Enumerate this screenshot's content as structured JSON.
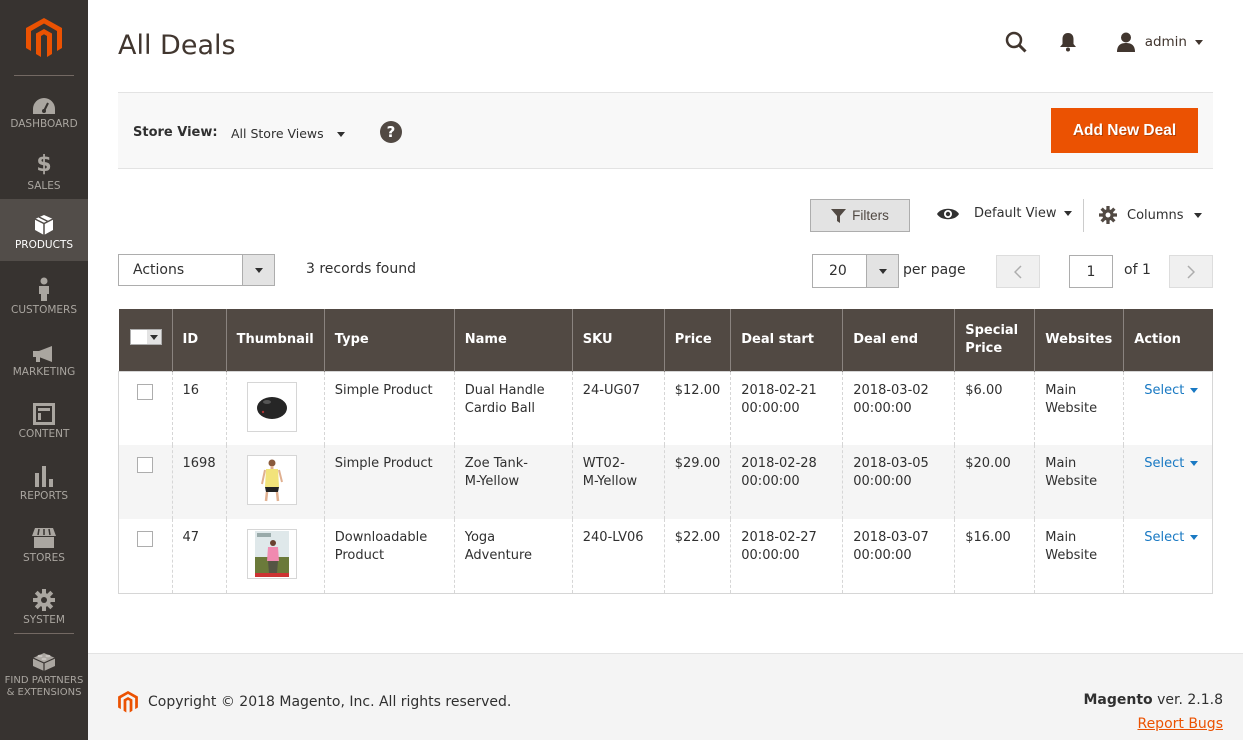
{
  "sidebar": {
    "items": [
      {
        "label": "DASHBOARD",
        "icon": "dashboard-icon"
      },
      {
        "label": "SALES",
        "icon": "dollar-icon"
      },
      {
        "label": "PRODUCTS",
        "icon": "box-icon",
        "active": true
      },
      {
        "label": "CUSTOMERS",
        "icon": "person-icon"
      },
      {
        "label": "MARKETING",
        "icon": "megaphone-icon"
      },
      {
        "label": "CONTENT",
        "icon": "layout-icon"
      },
      {
        "label": "REPORTS",
        "icon": "bar-chart-icon"
      },
      {
        "label": "STORES",
        "icon": "storefront-icon"
      },
      {
        "label": "SYSTEM",
        "icon": "gear-icon"
      }
    ],
    "extensions": {
      "line1": "FIND PARTNERS",
      "line2": "& EXTENSIONS",
      "icon": "lego-block-icon"
    }
  },
  "header": {
    "title": "All Deals",
    "user": "admin"
  },
  "store_bar": {
    "label": "Store View:",
    "selected": "All Store Views",
    "add_button": "Add New Deal"
  },
  "toolbar": {
    "filters": "Filters",
    "view": "Default View",
    "columns": "Columns",
    "actions": "Actions",
    "records": "3 records found",
    "per_page_value": "20",
    "per_page_label": "per page",
    "page": "1",
    "of_pages": "of 1"
  },
  "grid": {
    "columns": [
      "ID",
      "Thumbnail",
      "Type",
      "Name",
      "SKU",
      "Price",
      "Deal start",
      "Deal end",
      "Special Price",
      "Websites",
      "Action"
    ],
    "special_price_line1": "Special",
    "special_price_line2": "Price",
    "rows": [
      {
        "id": "16",
        "thumb": "cardio-ball",
        "type": "Simple Product",
        "name": "Dual Handle Cardio Ball",
        "sku": "24-UG07",
        "price": "$12.00",
        "deal_start_date": "2018-02-21",
        "deal_start_time": "00:00:00",
        "deal_end_date": "2018-03-02",
        "deal_end_time": "00:00:00",
        "special_price": "$6.00",
        "website_line1": "Main",
        "website_line2": "Website",
        "action": "Select"
      },
      {
        "id": "1698",
        "thumb": "tank-top",
        "type": "Simple Product",
        "name_line1": "Zoe Tank-",
        "name_line2": "M-Yellow",
        "sku_line1": "WT02-",
        "sku_line2": "M-Yellow",
        "price": "$29.00",
        "deal_start_date": "2018-02-28",
        "deal_start_time": "00:00:00",
        "deal_end_date": "2018-03-05",
        "deal_end_time": "00:00:00",
        "special_price": "$20.00",
        "website_line1": "Main",
        "website_line2": "Website",
        "action": "Select"
      },
      {
        "id": "47",
        "thumb": "yoga-dvd",
        "type_line1": "Downloadable",
        "type_line2": "Product",
        "name": "Yoga Adventure",
        "sku": "240-LV06",
        "price": "$22.00",
        "deal_start_date": "2018-02-27",
        "deal_start_time": "00:00:00",
        "deal_end_date": "2018-03-07",
        "deal_end_time": "00:00:00",
        "special_price": "$16.00",
        "website_line1": "Main",
        "website_line2": "Website",
        "action": "Select"
      }
    ]
  },
  "footer": {
    "copyright": "Copyright © 2018 Magento, Inc. All rights reserved.",
    "brand": "Magento",
    "version": " ver. 2.1.8",
    "report_bugs": "Report Bugs"
  },
  "colors": {
    "brand_orange": "#eb5202",
    "sidebar_bg": "#373330",
    "grid_header_bg": "#514943",
    "link_blue": "#1979c3"
  }
}
